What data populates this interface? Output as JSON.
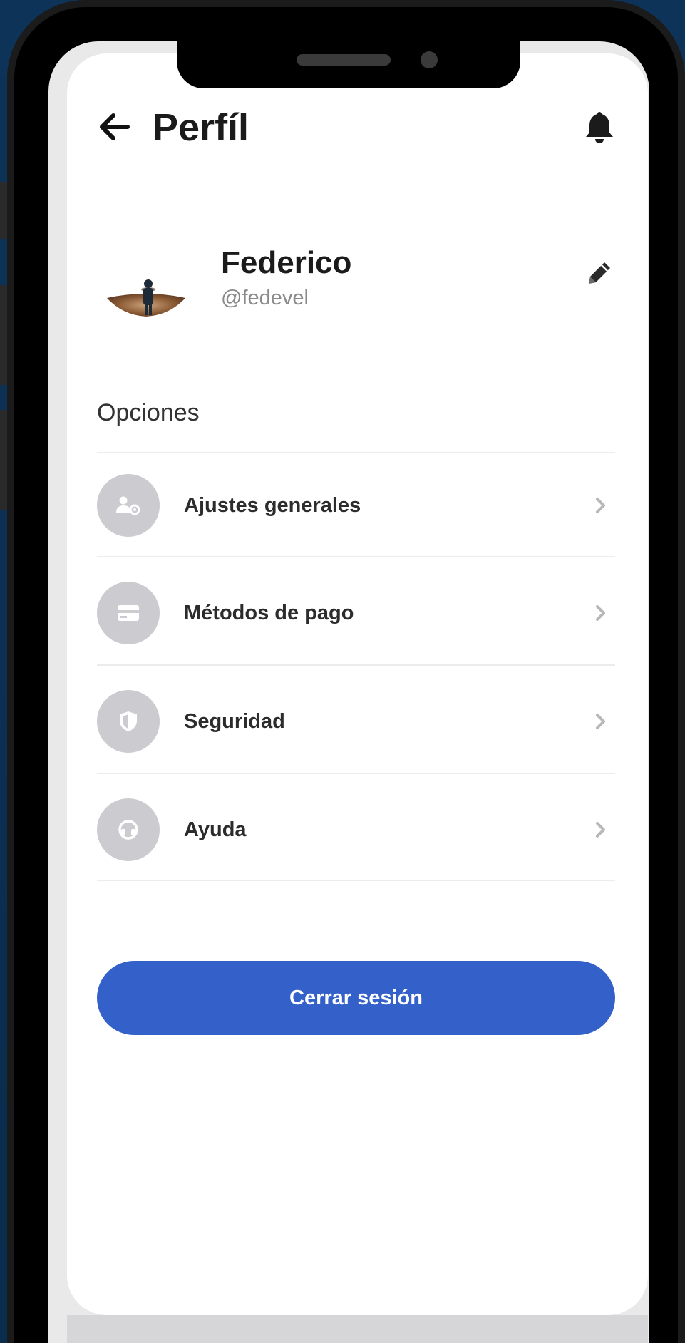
{
  "colors": {
    "background": "#0b3155",
    "primary": "#3461c9",
    "icon_circle": "#cbcbd0",
    "text_dark": "#1b1b1b",
    "text_muted": "#8a8a8a"
  },
  "header": {
    "title": "Perfíl",
    "back_icon": "arrow-left-icon",
    "notification_icon": "bell-icon"
  },
  "profile": {
    "name": "Federico",
    "handle": "@fedevel",
    "edit_icon": "pencil-icon"
  },
  "options": {
    "section_title": "Opciones",
    "items": [
      {
        "label": "Ajustes generales",
        "icon": "user-settings-icon"
      },
      {
        "label": "Métodos de pago",
        "icon": "credit-card-icon"
      },
      {
        "label": "Seguridad",
        "icon": "shield-icon"
      },
      {
        "label": "Ayuda",
        "icon": "help-icon"
      }
    ]
  },
  "logout": {
    "label": "Cerrar sesión"
  }
}
